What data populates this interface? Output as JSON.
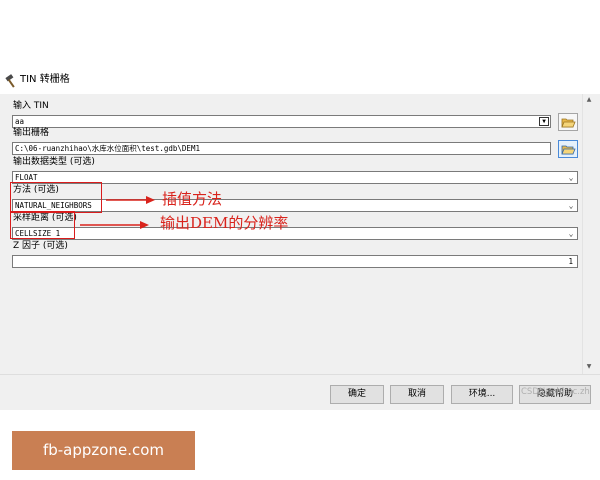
{
  "window": {
    "title": "TIN 转栅格"
  },
  "fields": {
    "input_tin": {
      "label": "输入 TIN",
      "value": "aa"
    },
    "output_raster": {
      "label": "输出栅格",
      "value": "C:\\06-ruanzhihao\\水库水位面积\\test.gdb\\DEM1"
    },
    "data_type": {
      "label": "输出数据类型 (可选)",
      "value": "FLOAT"
    },
    "method": {
      "label": "方法 (可选)",
      "value": "NATURAL_NEIGHBORS"
    },
    "sampling": {
      "label": "采样距离 (可选)",
      "value": "CELLSIZE 1"
    },
    "z_factor": {
      "label": "Z 因子 (可选)",
      "value": "1"
    }
  },
  "annotations": {
    "method_note": "插值方法",
    "sampling_note": "输出DEM的分辨率",
    "color": "#d9231c"
  },
  "buttons": {
    "ok": "确定",
    "cancel": "取消",
    "environments": "环境...",
    "help": "隐藏帮助"
  },
  "watermark": "CSDN @hhuc.zh",
  "brand": {
    "text": "fb-appzone.com",
    "color": "#c97f53"
  },
  "icons": {
    "title": "hammer-icon",
    "open": "folder-open-icon"
  }
}
